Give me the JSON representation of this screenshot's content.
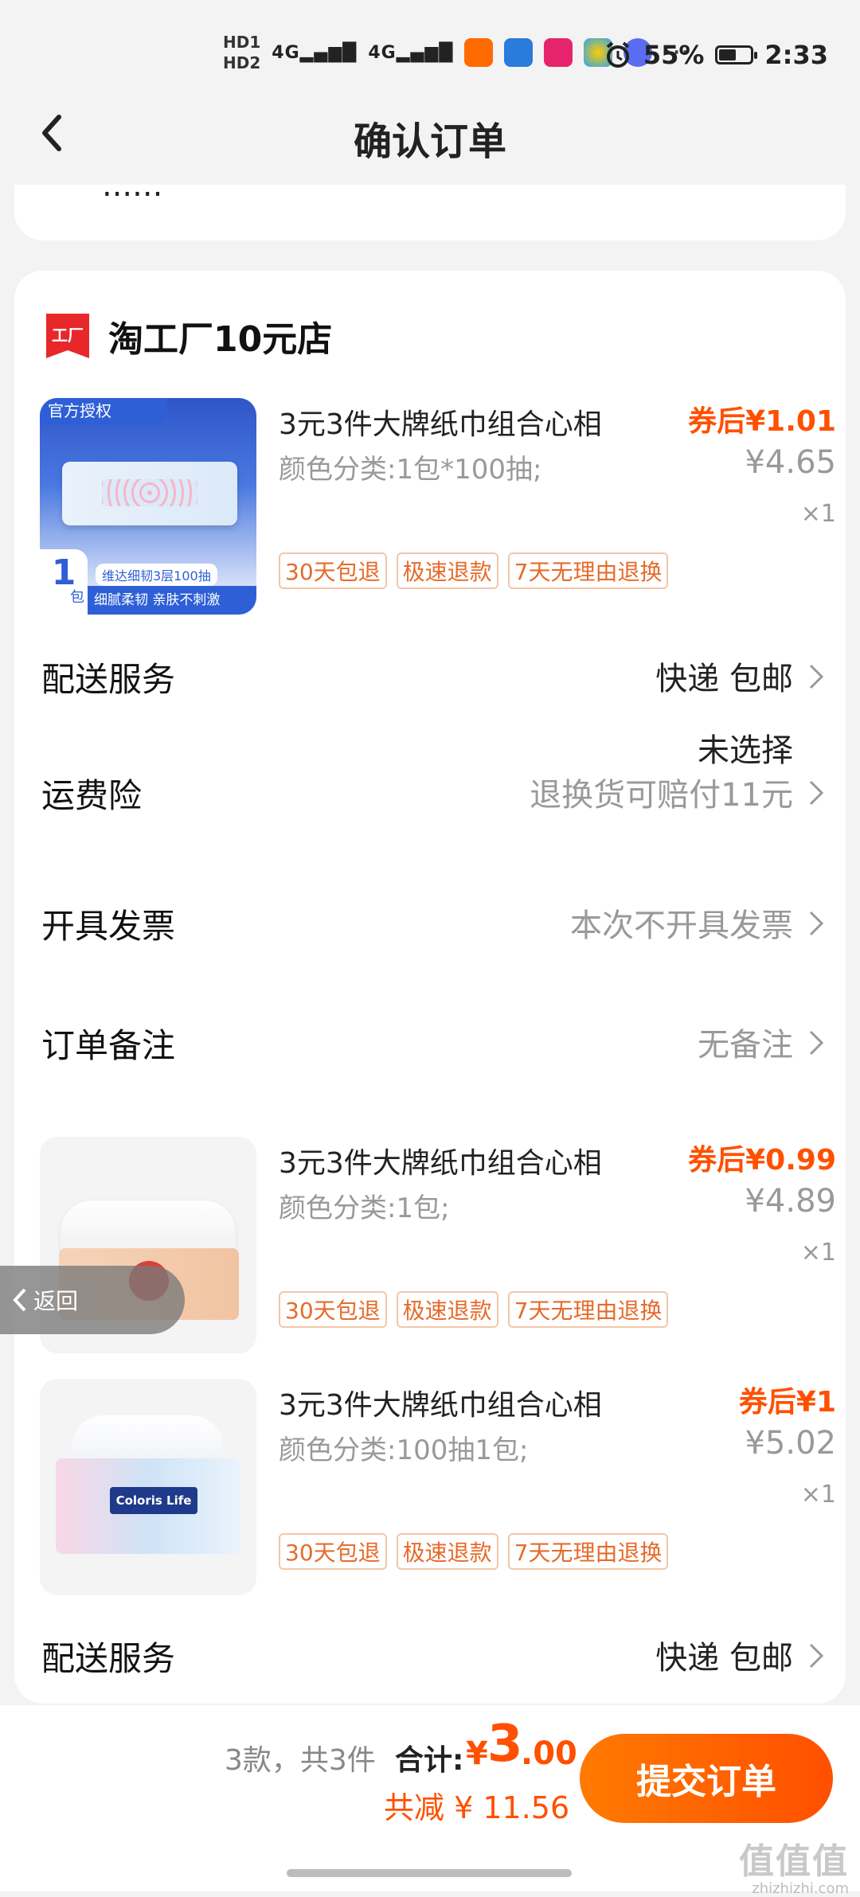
{
  "status_bar": {
    "hd1": "HD1",
    "hd2": "HD2",
    "signal1": "4G",
    "signal2": "4G",
    "more": "···",
    "battery_percent": "55%",
    "battery_level": 0.55,
    "time": "2:33"
  },
  "header": {
    "title": "确认订单"
  },
  "partial_card_text": "......",
  "shop": {
    "name": "淘工厂10元店",
    "logo_text": "工厂"
  },
  "products": [
    {
      "title": "3元3件大牌纸巾组合心相",
      "spec": "颜色分类:1包*100抽;",
      "coupon_price": "券后¥1.01",
      "price": "¥4.65",
      "qty": "×1",
      "tags": [
        "30天包退",
        "极速退款",
        "7天无理由退换"
      ],
      "thumb_badge": "官方授权",
      "thumb_count": "1",
      "thumb_unit": "包",
      "thumb_line1": "维达细韧3层100抽",
      "thumb_line2": "细腻柔韧 亲肤不刺激"
    },
    {
      "title": "3元3件大牌纸巾组合心相",
      "spec": "颜色分类:1包;",
      "coupon_price": "券后¥0.99",
      "price": "¥4.89",
      "qty": "×1",
      "tags": [
        "30天包退",
        "极速退款",
        "7天无理由退换"
      ]
    },
    {
      "title": "3元3件大牌纸巾组合心相",
      "spec": "颜色分类:100抽1包;",
      "coupon_price": "券后¥1",
      "price": "¥5.02",
      "qty": "×1",
      "tags": [
        "30天包退",
        "极速退款",
        "7天无理由退换"
      ],
      "thumb_brand": "Coloris Life"
    }
  ],
  "rows": {
    "delivery": {
      "label": "配送服务",
      "value": "快递 包邮"
    },
    "insurance": {
      "label": "运费险",
      "value": "未选择",
      "sub": "退换货可赔付11元"
    },
    "invoice": {
      "label": "开具发票",
      "value": "本次不开具发票"
    },
    "note": {
      "label": "订单备注",
      "value": "无备注"
    },
    "delivery2": {
      "label": "配送服务",
      "value": "快递 包邮"
    }
  },
  "float_back": {
    "label": "返回"
  },
  "bottom": {
    "count": "3款，共3件",
    "total_label": "合计:",
    "yen": "¥",
    "amount_int": "3",
    "amount_dec": ".00",
    "saved": "共减 ¥ 11.56",
    "submit": "提交订单"
  },
  "watermark": {
    "logo": "值值值",
    "url": "zhizhizhi.com"
  },
  "colors": {
    "accent": "#ff5000",
    "submit_start": "#ff7a00",
    "submit_end": "#ff4f00",
    "tag_text": "#e66b2b"
  }
}
